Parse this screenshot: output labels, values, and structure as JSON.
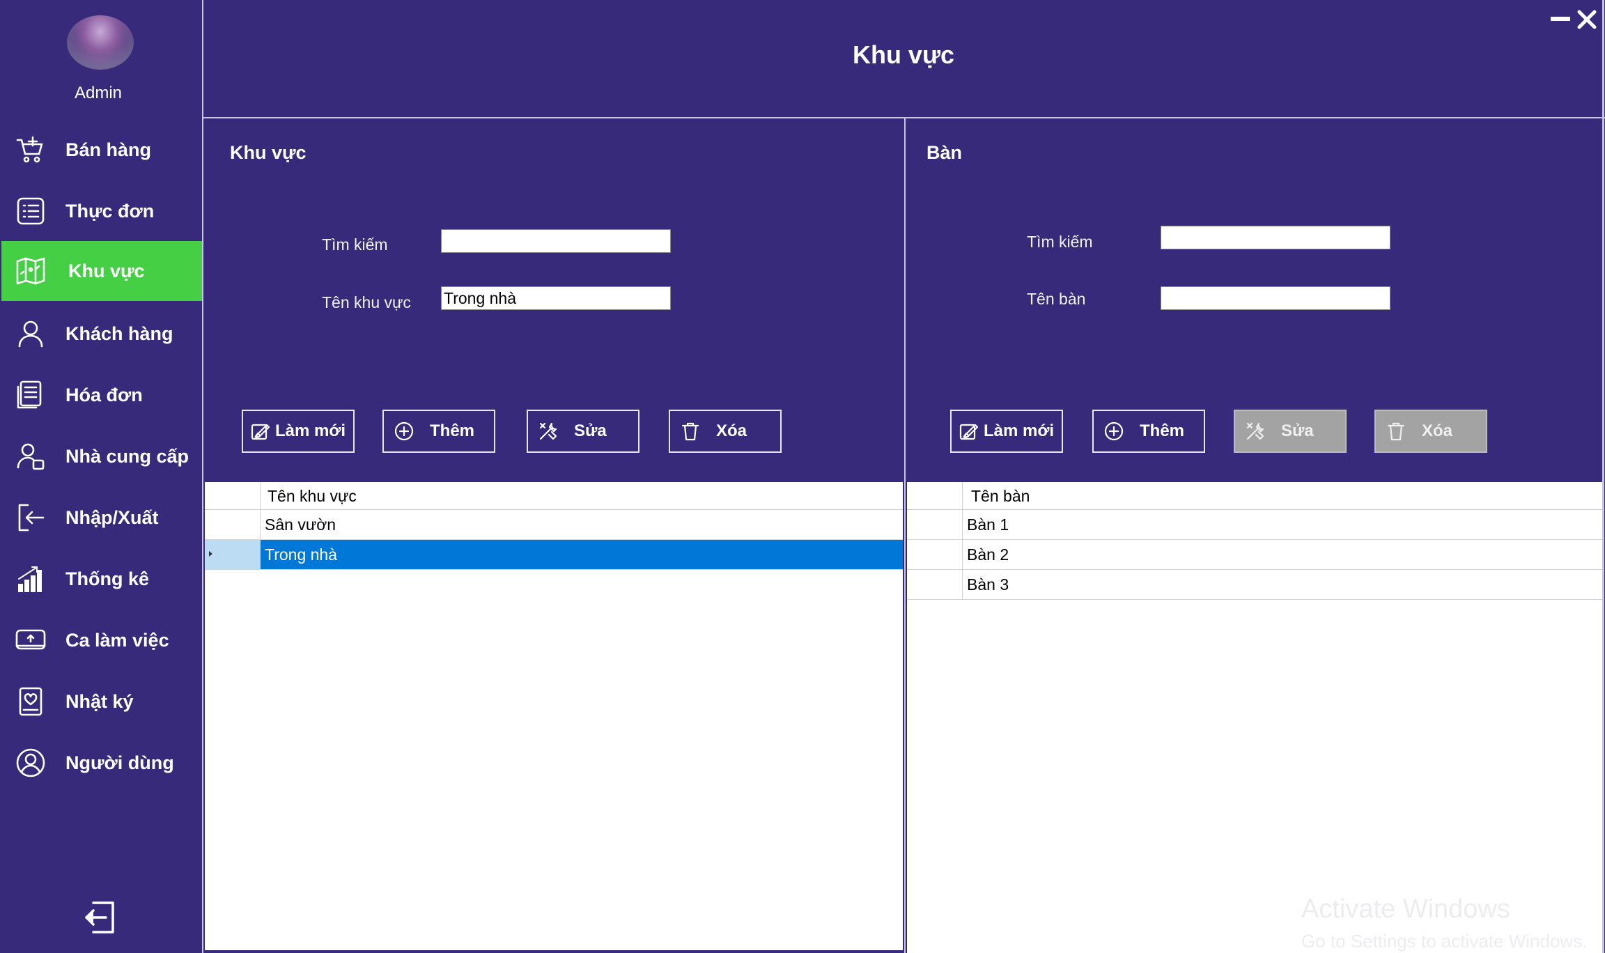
{
  "window": {
    "title": "Khu vực"
  },
  "sidebar": {
    "user_label": "Admin",
    "items": [
      {
        "label": "Bán hàng",
        "icon": "cart-icon",
        "active": false
      },
      {
        "label": "Thực đơn",
        "icon": "menu-list-icon",
        "active": false
      },
      {
        "label": "Khu vực",
        "icon": "map-icon",
        "active": true
      },
      {
        "label": "Khách hàng",
        "icon": "customer-icon",
        "active": false
      },
      {
        "label": "Hóa đơn",
        "icon": "invoice-icon",
        "active": false
      },
      {
        "label": "Nhà cung cấp",
        "icon": "supplier-icon",
        "active": false
      },
      {
        "label": "Nhập/Xuất",
        "icon": "import-export-icon",
        "active": false
      },
      {
        "label": "Thống kê",
        "icon": "chart-icon",
        "active": false
      },
      {
        "label": "Ca làm việc",
        "icon": "shift-icon",
        "active": false
      },
      {
        "label": "Nhật ký",
        "icon": "log-icon",
        "active": false
      },
      {
        "label": "Người dùng",
        "icon": "user-icon",
        "active": false
      }
    ],
    "active_color": "#45cf45"
  },
  "area_panel": {
    "title": "Khu vực",
    "search_label": "Tìm kiếm",
    "search_value": "",
    "name_label": "Tên khu vực",
    "name_value": "Trong nhà",
    "buttons": {
      "refresh": "Làm mới",
      "add": "Thêm",
      "edit": "Sửa",
      "delete": "Xóa"
    },
    "grid": {
      "column": "Tên khu vực",
      "rows": [
        "Sân vườn",
        "Trong nhà"
      ],
      "selected_index": 1
    }
  },
  "table_panel": {
    "title": "Bàn",
    "search_label": "Tìm kiếm",
    "search_value": "",
    "name_label": "Tên bàn",
    "name_value": "",
    "buttons": {
      "refresh": "Làm mới",
      "add": "Thêm",
      "edit": "Sửa",
      "delete": "Xóa"
    },
    "grid": {
      "column": "Tên bàn",
      "rows": [
        "Bàn 1",
        "Bàn 2",
        "Bàn 3"
      ]
    }
  },
  "watermark": {
    "line1": "Activate Windows",
    "line2": "Go to Settings to activate Windows."
  },
  "colors": {
    "background": "#372a7a",
    "selection": "#0078d7"
  }
}
